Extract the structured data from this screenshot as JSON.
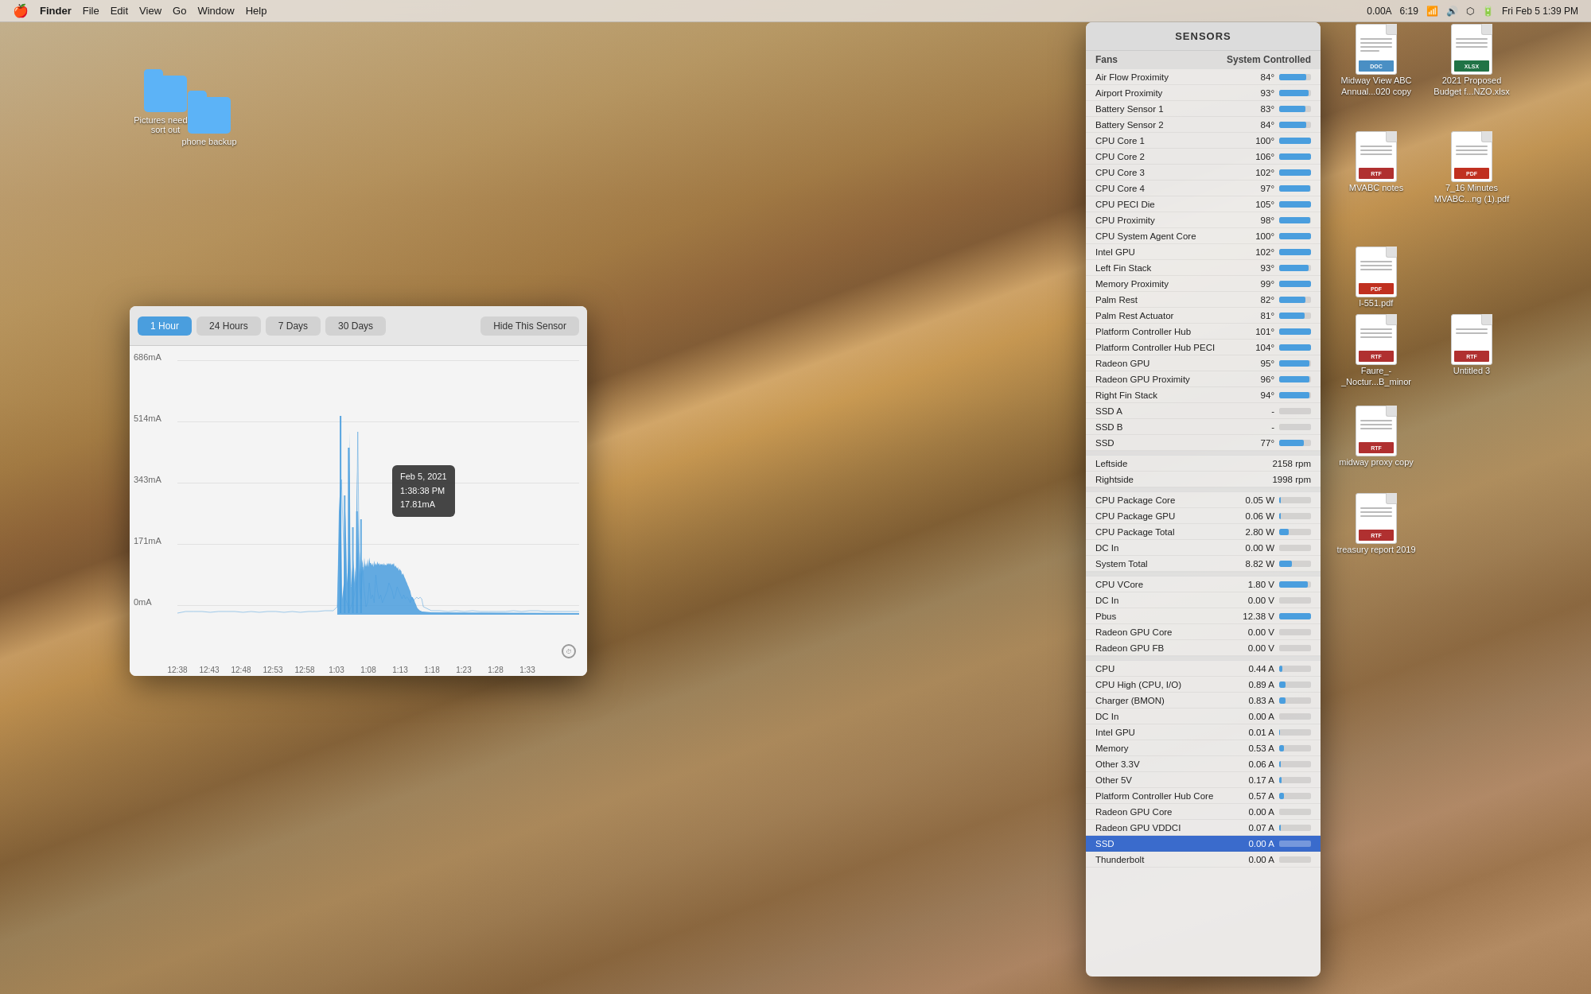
{
  "menubar": {
    "apple": "🍎",
    "items": [
      "Finder",
      "File",
      "Edit",
      "View",
      "Go",
      "Window",
      "Help"
    ],
    "right": {
      "current_app": "0.00A",
      "battery_time": "6:19",
      "date_time": "Fri Feb 5  1:39 PM"
    }
  },
  "sensor_panel": {
    "title": "SENSORS",
    "sections": {
      "fans_header": "Fans",
      "fans_header_value": "System Controlled",
      "temperature_rows": [
        {
          "name": "Air Flow Proximity",
          "value": "84°",
          "bar": 84
        },
        {
          "name": "Airport Proximity",
          "value": "93°",
          "bar": 93
        },
        {
          "name": "Battery Sensor 1",
          "value": "83°",
          "bar": 83
        },
        {
          "name": "Battery Sensor 2",
          "value": "84°",
          "bar": 84
        },
        {
          "name": "CPU Core 1",
          "value": "100°",
          "bar": 100
        },
        {
          "name": "CPU Core 2",
          "value": "106°",
          "bar": 100
        },
        {
          "name": "CPU Core 3",
          "value": "102°",
          "bar": 100
        },
        {
          "name": "CPU Core 4",
          "value": "97°",
          "bar": 97
        },
        {
          "name": "CPU PECI Die",
          "value": "105°",
          "bar": 100
        },
        {
          "name": "CPU Proximity",
          "value": "98°",
          "bar": 98
        },
        {
          "name": "CPU System Agent Core",
          "value": "100°",
          "bar": 100
        },
        {
          "name": "Intel GPU",
          "value": "102°",
          "bar": 100
        },
        {
          "name": "Left Fin Stack",
          "value": "93°",
          "bar": 93
        },
        {
          "name": "Memory Proximity",
          "value": "99°",
          "bar": 99
        },
        {
          "name": "Palm Rest",
          "value": "82°",
          "bar": 82
        },
        {
          "name": "Palm Rest Actuator",
          "value": "81°",
          "bar": 81
        },
        {
          "name": "Platform Controller Hub",
          "value": "101°",
          "bar": 100
        },
        {
          "name": "Platform Controller Hub PECI",
          "value": "104°",
          "bar": 100
        },
        {
          "name": "Radeon GPU",
          "value": "95°",
          "bar": 95
        },
        {
          "name": "Radeon GPU Proximity",
          "value": "96°",
          "bar": 96
        },
        {
          "name": "Right Fin Stack",
          "value": "94°",
          "bar": 94
        },
        {
          "name": "SSD A",
          "value": "-",
          "bar": 0
        },
        {
          "name": "SSD B",
          "value": "-",
          "bar": 0
        },
        {
          "name": "SSD",
          "value": "77°",
          "bar": 77
        }
      ],
      "fan_rows": [
        {
          "name": "Leftside",
          "value": "2158 rpm"
        },
        {
          "name": "Rightside",
          "value": "1998 rpm"
        }
      ],
      "power_rows": [
        {
          "name": "CPU Package Core",
          "value": "0.05 W",
          "bar": 5
        },
        {
          "name": "CPU Package GPU",
          "value": "0.06 W",
          "bar": 6
        },
        {
          "name": "CPU Package Total",
          "value": "2.80 W",
          "bar": 28
        },
        {
          "name": "DC In",
          "value": "0.00 W",
          "bar": 0
        },
        {
          "name": "System Total",
          "value": "8.82 W",
          "bar": 40
        }
      ],
      "voltage_rows": [
        {
          "name": "CPU VCore",
          "value": "1.80 V",
          "bar": 90
        },
        {
          "name": "DC In",
          "value": "0.00 V",
          "bar": 0
        },
        {
          "name": "Pbus",
          "value": "12.38 V",
          "bar": 100
        },
        {
          "name": "Radeon GPU Core",
          "value": "0.00 V",
          "bar": 0
        },
        {
          "name": "Radeon GPU FB",
          "value": "0.00 V",
          "bar": 0
        }
      ],
      "current_rows": [
        {
          "name": "CPU",
          "value": "0.44 A",
          "bar": 10
        },
        {
          "name": "CPU High (CPU, I/O)",
          "value": "0.89 A",
          "bar": 20
        },
        {
          "name": "Charger (BMON)",
          "value": "0.83 A",
          "bar": 20
        },
        {
          "name": "DC In",
          "value": "0.00 A",
          "bar": 0
        },
        {
          "name": "Intel GPU",
          "value": "0.01 A",
          "bar": 2
        },
        {
          "name": "Memory",
          "value": "0.53 A",
          "bar": 15
        },
        {
          "name": "Other 3.3V",
          "value": "0.06 A",
          "bar": 5
        },
        {
          "name": "Other 5V",
          "value": "0.17 A",
          "bar": 8
        },
        {
          "name": "Platform Controller Hub Core",
          "value": "0.57 A",
          "bar": 15
        },
        {
          "name": "Radeon GPU Core",
          "value": "0.00 A",
          "bar": 0
        },
        {
          "name": "Radeon GPU VDDCI",
          "value": "0.07 A",
          "bar": 5
        },
        {
          "name": "SSD",
          "value": "0.00 A",
          "bar": 0,
          "selected": true
        },
        {
          "name": "Thunderbolt",
          "value": "0.00 A",
          "bar": 0
        }
      ]
    }
  },
  "graph": {
    "time_buttons": [
      "1 Hour",
      "24 Hours",
      "7 Days",
      "30 Days"
    ],
    "active_button": "1 Hour",
    "hide_button": "Hide This Sensor",
    "y_labels": [
      "686mA",
      "514mA",
      "343mA",
      "171mA",
      "0mA"
    ],
    "x_labels": [
      "12:38",
      "12:43",
      "12:48",
      "12:53",
      "12:58",
      "1:03",
      "1:08",
      "1:13",
      "1:18",
      "1:23",
      "1:28",
      "1:33"
    ],
    "tooltip": {
      "date": "Feb 5, 2021",
      "time": "1:38:38 PM",
      "value": "17.81mA"
    }
  },
  "desktop_icons": [
    {
      "id": "midway-view",
      "label": "Midway View ABC Annual...020 copy",
      "type": "doc",
      "ext": ""
    },
    {
      "id": "proposed-budget",
      "label": "2021 Proposed Budget f...NZO.xlsx",
      "type": "xlsx",
      "ext": "XLSX"
    },
    {
      "id": "mvabc-notes",
      "label": "MVABC notes",
      "type": "rtf",
      "ext": "RTF"
    },
    {
      "id": "7-16-minutes",
      "label": "7_16 Minutes MVABC...ng (1).pdf",
      "type": "pdf",
      "ext": "PDF"
    },
    {
      "id": "l-551",
      "label": "l-551.pdf",
      "type": "pdf",
      "ext": "PDF"
    },
    {
      "id": "faure-nocturne",
      "label": "Faure_-_Noctur...B_minor",
      "type": "rtf",
      "ext": "RTF"
    },
    {
      "id": "untitled-3",
      "label": "Untitled 3",
      "type": "rtf",
      "ext": "RTF"
    },
    {
      "id": "midway-proxy",
      "label": "midway proxy copy",
      "type": "rtf",
      "ext": "RTF"
    },
    {
      "id": "treasury-report",
      "label": "treasury report 2019",
      "type": "rtf",
      "ext": "RTF"
    }
  ],
  "desktop_folders": [
    {
      "id": "pictures",
      "label": "Pictures need to sort out"
    },
    {
      "id": "phone-backup",
      "label": "phone backup"
    }
  ]
}
